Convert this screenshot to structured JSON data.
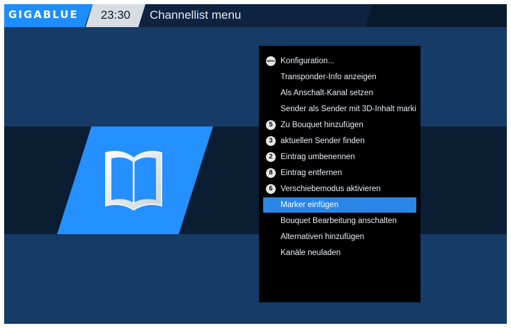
{
  "header": {
    "logo": "GIGABLUE",
    "time": "23:30",
    "title": "Channellist menu"
  },
  "colors": {
    "accent": "#2590ff",
    "background": "#153b66",
    "selection": "#2a86e6"
  },
  "center_icon": "open-book-icon",
  "context_menu": {
    "items": [
      {
        "key": "MENU",
        "label": "Konfiguration..."
      },
      {
        "key": "",
        "label": "Transponder-Info anzeigen"
      },
      {
        "key": "",
        "label": "Als Anschalt-Kanal setzen"
      },
      {
        "key": "",
        "label": "Sender als Sender mit 3D-Inhalt marki"
      },
      {
        "key": "5",
        "label": "Zu Bouquet hinzufügen"
      },
      {
        "key": "3",
        "label": "aktuellen Sender finden"
      },
      {
        "key": "2",
        "label": "Eintrag umbenennen"
      },
      {
        "key": "8",
        "label": "Eintrag entfernen"
      },
      {
        "key": "6",
        "label": "Verschiebemodus aktivieren"
      },
      {
        "key": "",
        "label": "Marker einfügen"
      },
      {
        "key": "",
        "label": "Bouquet Bearbeitung anschalten"
      },
      {
        "key": "",
        "label": "Alternativen hinzufügen"
      },
      {
        "key": "",
        "label": "Kanäle neuladen"
      }
    ],
    "selected_index": 9
  }
}
